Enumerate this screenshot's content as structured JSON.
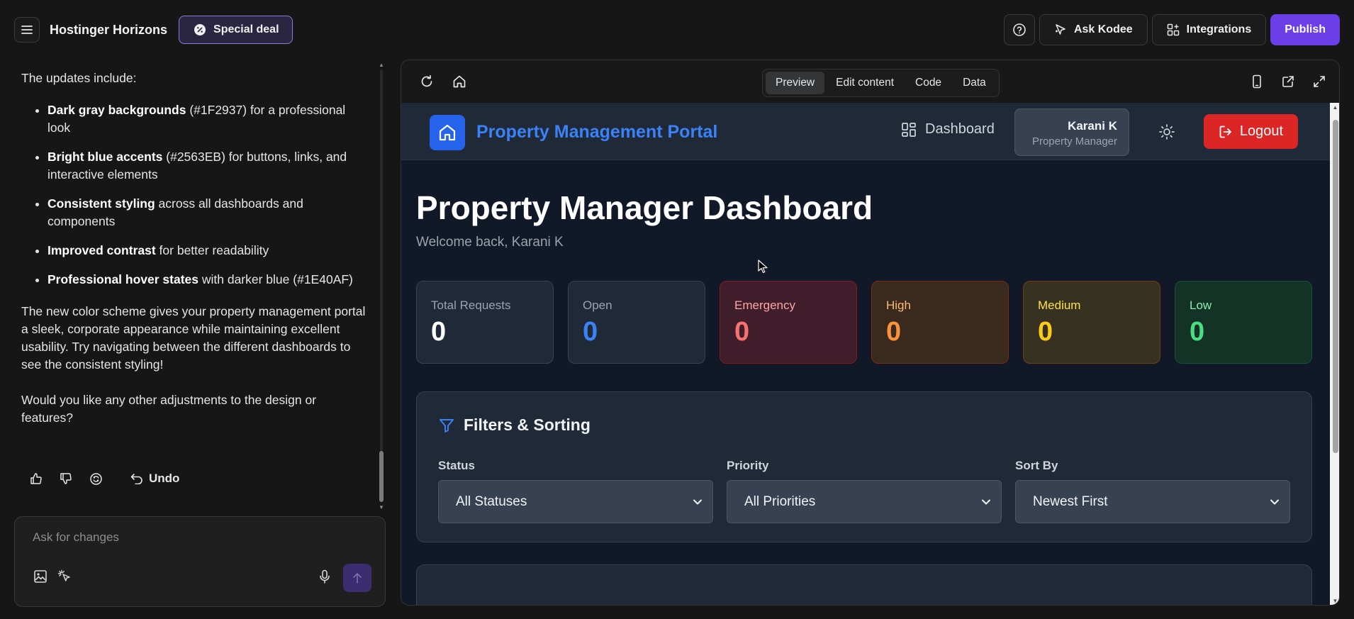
{
  "topbar": {
    "brand": "Hostinger Horizons",
    "deal_label": "Special deal",
    "ask_label": "Ask Kodee",
    "integrations_label": "Integrations",
    "publish_label": "Publish"
  },
  "chat": {
    "intro": "The updates include:",
    "bullets": [
      {
        "bold": "Dark gray backgrounds",
        "rest": " (#1F2937) for a professional look"
      },
      {
        "bold": "Bright blue accents",
        "rest": " (#2563EB) for buttons, links, and interactive elements"
      },
      {
        "bold": "Consistent styling",
        "rest": " across all dashboards and components"
      },
      {
        "bold": "Improved contrast",
        "rest": " for better readability"
      },
      {
        "bold": "Professional hover states",
        "rest": " with darker blue (#1E40AF)"
      }
    ],
    "paragraph1": "The new color scheme gives your property management portal a sleek, corporate appearance while maintaining excellent usability. Try navigating between the different dashboards to see the consistent styling!",
    "paragraph2": "Would you like any other adjustments to the design or features?",
    "undo_label": "Undo",
    "composer_placeholder": "Ask for changes"
  },
  "preview": {
    "tabs": [
      {
        "label": "Preview",
        "active": true
      },
      {
        "label": "Edit content",
        "active": false
      },
      {
        "label": "Code",
        "active": false
      },
      {
        "label": "Data",
        "active": false
      }
    ]
  },
  "app": {
    "title": "Property Management Portal",
    "nav_dashboard": "Dashboard",
    "user_name": "Karani K",
    "user_role": "Property Manager",
    "logout_label": "Logout",
    "page_title": "Property Manager Dashboard",
    "welcome": "Welcome back, Karani K",
    "stats": [
      {
        "label": "Total Requests",
        "value": "0",
        "bg": "#1F2937",
        "border": "#374151",
        "label_color": "#9CA3AF",
        "value_color": "#FFFFFF"
      },
      {
        "label": "Open",
        "value": "0",
        "bg": "#1F2937",
        "border": "#374151",
        "label_color": "#9CA3AF",
        "value_color": "#3B82F6"
      },
      {
        "label": "Emergency",
        "value": "0",
        "bg": "#3F1D2A",
        "border": "#7F1D1D",
        "label_color": "#FCA5A5",
        "value_color": "#F87171"
      },
      {
        "label": "High",
        "value": "0",
        "bg": "#3A2A1D",
        "border": "#7C2D12",
        "label_color": "#FDBA74",
        "value_color": "#FB923C"
      },
      {
        "label": "Medium",
        "value": "0",
        "bg": "#363120",
        "border": "#713F12",
        "label_color": "#FDE047",
        "value_color": "#FACC15"
      },
      {
        "label": "Low",
        "value": "0",
        "bg": "#143327",
        "border": "#14532D",
        "label_color": "#86EFAC",
        "value_color": "#4ADE80"
      }
    ],
    "filters": {
      "title": "Filters & Sorting",
      "groups": [
        {
          "label": "Status",
          "value": "All Statuses"
        },
        {
          "label": "Priority",
          "value": "All Priorities"
        },
        {
          "label": "Sort By",
          "value": "Newest First"
        }
      ]
    }
  },
  "colors": {
    "accent": "#2563EB",
    "publish": "#6C3EE8",
    "logout": "#DC2626"
  }
}
